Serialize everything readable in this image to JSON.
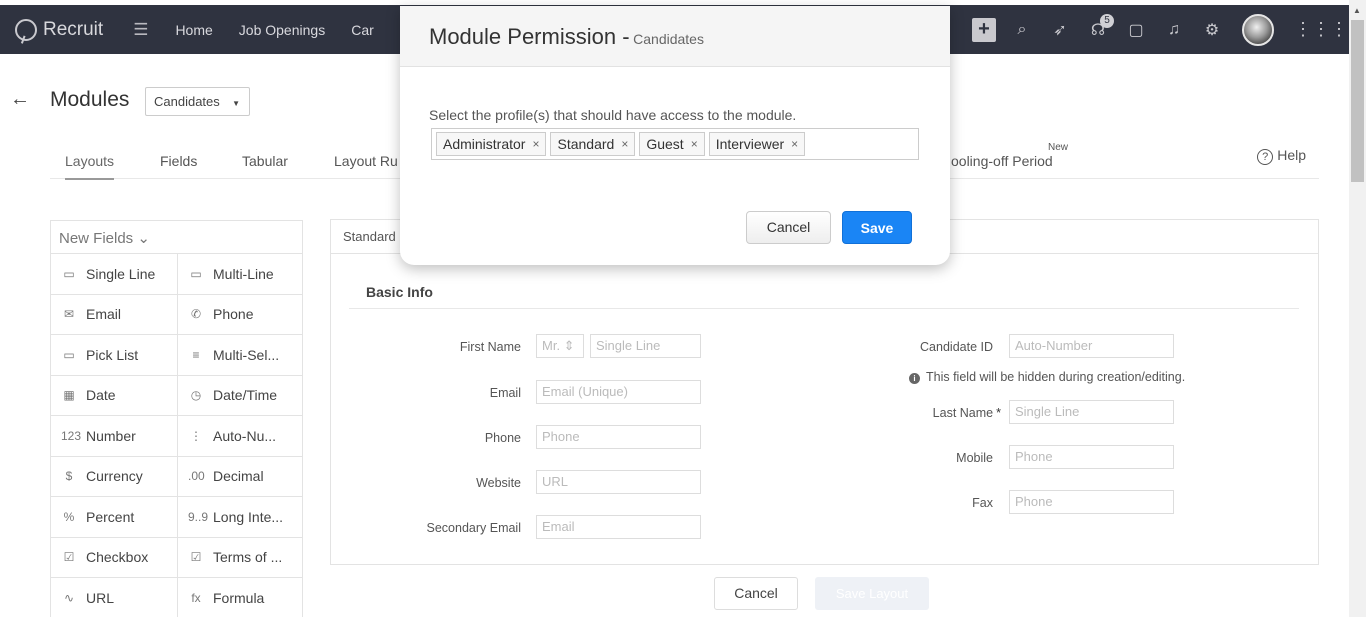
{
  "nav": {
    "brand": "Recruit",
    "links": [
      "Home",
      "Job Openings",
      "Car"
    ],
    "badge_count": "5"
  },
  "page": {
    "title": "Modules",
    "module_select": "Candidates",
    "tabs": [
      "Layouts",
      "Fields",
      "Tabular",
      "Layout Ru",
      "ooling-off Period"
    ],
    "new_tag": "New",
    "help": "Help"
  },
  "palette": {
    "header": "New Fields",
    "rows": [
      [
        "Single Line",
        "Multi-Line"
      ],
      [
        "Email",
        "Phone"
      ],
      [
        "Pick List",
        "Multi-Sel..."
      ],
      [
        "Date",
        "Date/Time"
      ],
      [
        "Number",
        "Auto-Nu..."
      ],
      [
        "Currency",
        "Decimal"
      ],
      [
        "Percent",
        "Long Inte..."
      ],
      [
        "Checkbox",
        "Terms of ..."
      ],
      [
        "URL",
        "Formula"
      ]
    ],
    "icons": [
      [
        "▭",
        "▭"
      ],
      [
        "✉",
        "✆"
      ],
      [
        "▭",
        "≡"
      ],
      [
        "▦",
        "◷"
      ],
      [
        "123",
        "⋮"
      ],
      [
        "$",
        ".00"
      ],
      [
        "%",
        "9..9"
      ],
      [
        "☑",
        "☑"
      ],
      [
        "∿",
        "fx"
      ]
    ]
  },
  "canvas": {
    "header": "Standard",
    "section": "Basic Info",
    "left_fields": [
      {
        "label": "First Name",
        "salutation": "Mr.",
        "placeholder": "Single Line"
      },
      {
        "label": "Email",
        "placeholder": "Email (Unique)"
      },
      {
        "label": "Phone",
        "placeholder": "Phone"
      },
      {
        "label": "Website",
        "placeholder": "URL"
      },
      {
        "label": "Secondary Email",
        "placeholder": "Email"
      }
    ],
    "right_fields": [
      {
        "label": "Candidate ID",
        "placeholder": "Auto-Number"
      },
      {
        "label": "Last Name",
        "placeholder": "Single Line"
      },
      {
        "label": "Mobile",
        "placeholder": "Phone"
      },
      {
        "label": "Fax",
        "placeholder": "Phone"
      }
    ],
    "note": "This field will be hidden during creation/editing.",
    "required_mark": "*"
  },
  "footer": {
    "cancel": "Cancel",
    "save_layout": "Save Layout"
  },
  "modal": {
    "title": "Module Permission -",
    "subtitle": "Candidates",
    "label": "Select the profile(s) that should have access to the module.",
    "tags": [
      "Administrator",
      "Standard",
      "Guest",
      "Interviewer"
    ],
    "remove_glyph": "×",
    "cancel": "Cancel",
    "save": "Save"
  }
}
